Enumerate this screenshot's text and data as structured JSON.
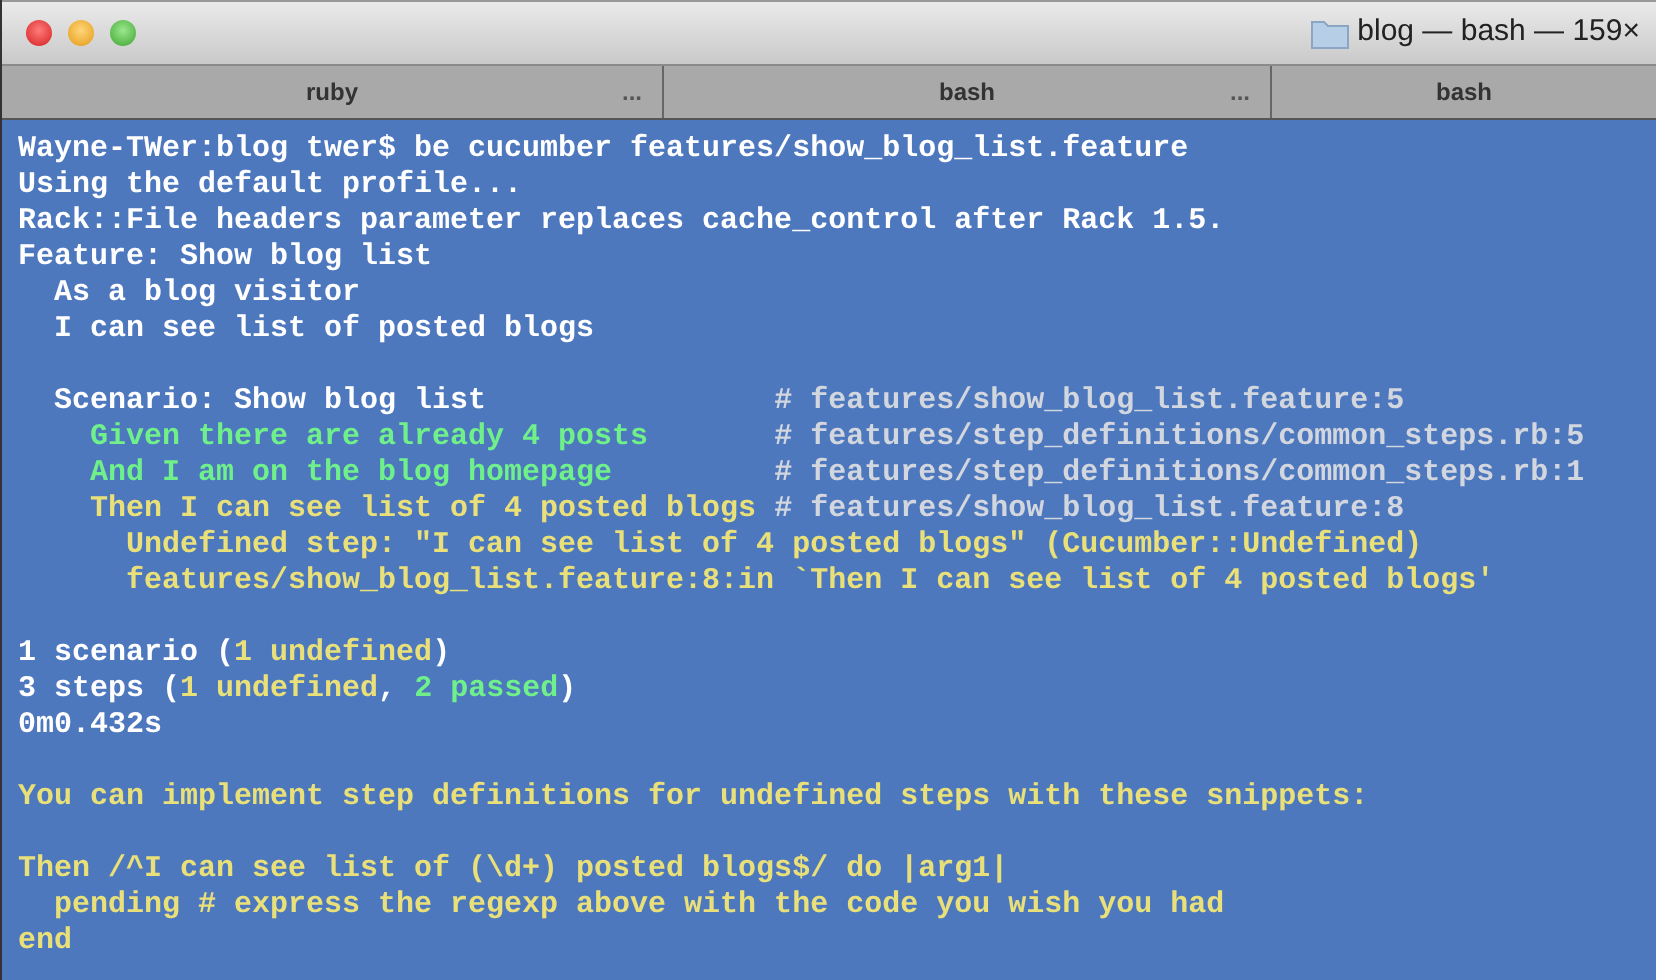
{
  "window": {
    "title": "blog — bash — 159×"
  },
  "tabs": [
    {
      "label": "ruby",
      "more": "..."
    },
    {
      "label": "bash",
      "more": "..."
    },
    {
      "label": "bash"
    }
  ],
  "terminal": {
    "blocks": [
      [
        [
          {
            "kind": "plain",
            "text": "Wayne-TWer:blog twer$ be cucumber features/show_blog_list.feature"
          }
        ],
        [
          {
            "kind": "plain",
            "text": "Using the default profile..."
          }
        ],
        [
          {
            "kind": "plain",
            "text": "Rack::File headers parameter replaces cache_control after Rack 1.5."
          }
        ],
        [
          {
            "kind": "plain",
            "text": "Feature: Show blog list"
          }
        ],
        [
          {
            "kind": "plain",
            "text": "  As a blog visitor"
          }
        ],
        [
          {
            "kind": "plain",
            "text": "  I can see list of posted blogs"
          }
        ]
      ],
      [
        [
          {
            "kind": "plain",
            "text": "  Scenario: Show blog list                "
          },
          {
            "kind": "comment",
            "text": "# features/show_blog_list.feature:5"
          }
        ],
        [
          {
            "kind": "passed",
            "text": "    Given there are already 4 posts       "
          },
          {
            "kind": "comment",
            "text": "# features/step_definitions/common_steps.rb:5"
          }
        ],
        [
          {
            "kind": "passed",
            "text": "    And I am on the blog homepage         "
          },
          {
            "kind": "comment",
            "text": "# features/step_definitions/common_steps.rb:1"
          }
        ],
        [
          {
            "kind": "undefined",
            "text": "    Then I can see list of 4 posted blogs "
          },
          {
            "kind": "comment",
            "text": "# features/show_blog_list.feature:8"
          }
        ],
        [
          {
            "kind": "undefined",
            "text": "      Undefined step: \"I can see list of 4 posted blogs\" (Cucumber::Undefined)"
          }
        ],
        [
          {
            "kind": "undefined",
            "text": "      features/show_blog_list.feature:8:in `Then I can see list of 4 posted blogs'"
          }
        ]
      ],
      [
        [
          {
            "kind": "plain",
            "text": "1 scenario ("
          },
          {
            "kind": "undefined",
            "text": "1 undefined"
          },
          {
            "kind": "plain",
            "text": ")"
          }
        ],
        [
          {
            "kind": "plain",
            "text": "3 steps ("
          },
          {
            "kind": "undefined",
            "text": "1 undefined"
          },
          {
            "kind": "plain",
            "text": ", "
          },
          {
            "kind": "passed",
            "text": "2 passed"
          },
          {
            "kind": "plain",
            "text": ")"
          }
        ],
        [
          {
            "kind": "plain",
            "text": "0m0.432s"
          }
        ]
      ],
      [
        [
          {
            "kind": "undefined",
            "text": "You can implement step definitions for undefined steps with these snippets:"
          }
        ]
      ],
      [
        [
          {
            "kind": "undefined",
            "text": "Then /^I can see list of (\\d+) posted blogs$/ do |arg1|"
          }
        ],
        [
          {
            "kind": "undefined",
            "text": "  pending # express the regexp above with the code you wish you had"
          }
        ],
        [
          {
            "kind": "undefined",
            "text": "end"
          }
        ]
      ]
    ]
  }
}
